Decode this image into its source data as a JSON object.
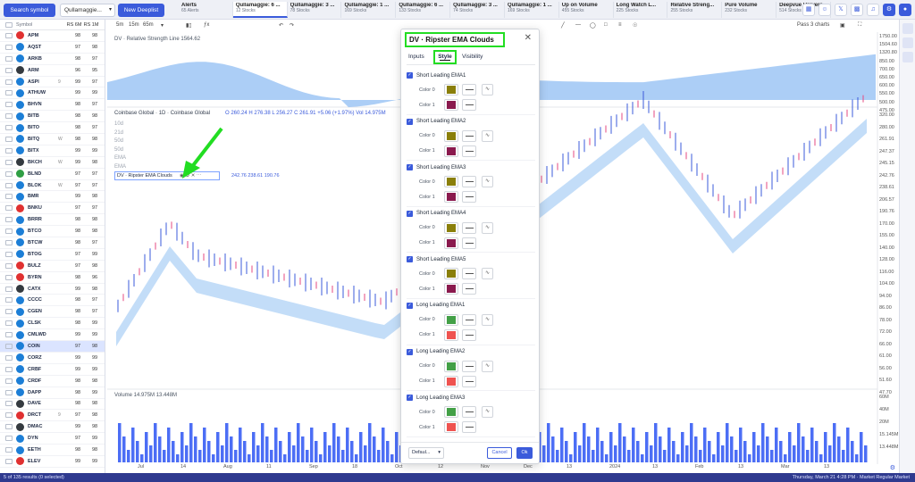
{
  "topbar": {
    "search_label": "Search symbol",
    "deeplist_value": "Qullamaggie...",
    "new_deeplist_label": "New Deeplist",
    "tabs": [
      {
        "title": "Alerts",
        "sub": "65 Alerts"
      },
      {
        "title": "Qullamaggie: 6 ...",
        "sub": "12 Stocks"
      },
      {
        "title": "Qullamaggie: 3 ...",
        "sub": "78 Stocks"
      },
      {
        "title": "Qullamaggie: 1 ...",
        "sub": "169 Stocks"
      },
      {
        "title": "Qullamaggie: 6 ...",
        "sub": "133 Stocks"
      },
      {
        "title": "Qullamaggie: 3 ...",
        "sub": "74 Stocks"
      },
      {
        "title": "Qullamaggie: 1 ...",
        "sub": "169 Stocks"
      },
      {
        "title": "Up on Volume",
        "sub": "455 Stocks"
      },
      {
        "title": "Long Watch L...",
        "sub": "225 Stocks"
      },
      {
        "title": "Relative Streng...",
        "sub": "255 Stocks"
      },
      {
        "title": "Pure Volume",
        "sub": "232 Stocks"
      },
      {
        "title": "Deepvue Univers...",
        "sub": "514 Stocks"
      }
    ]
  },
  "sidebar": {
    "header": {
      "symbol": "Symbol",
      "rs": "RS 6M",
      "m": "RS 1M"
    },
    "rows": [
      {
        "sym": "APM",
        "rs": "98",
        "m": "98",
        "color": "#e03131",
        "mark": ""
      },
      {
        "sym": "AQST",
        "rs": "97",
        "m": "98",
        "color": "#1c7ed6",
        "mark": ""
      },
      {
        "sym": "ARKB",
        "rs": "98",
        "m": "97",
        "color": "#1c7ed6",
        "mark": ""
      },
      {
        "sym": "ARM",
        "rs": "96",
        "m": "95",
        "color": "#343a40",
        "mark": ""
      },
      {
        "sym": "ASPI",
        "rs": "99",
        "m": "97",
        "color": "#1c7ed6",
        "mark": "9"
      },
      {
        "sym": "ATHUW",
        "rs": "99",
        "m": "99",
        "color": "#1c7ed6",
        "mark": ""
      },
      {
        "sym": "BHVN",
        "rs": "98",
        "m": "97",
        "color": "#1c7ed6",
        "mark": ""
      },
      {
        "sym": "BITB",
        "rs": "98",
        "m": "98",
        "color": "#1c7ed6",
        "mark": ""
      },
      {
        "sym": "BITO",
        "rs": "98",
        "m": "97",
        "color": "#1c7ed6",
        "mark": ""
      },
      {
        "sym": "BITQ",
        "rs": "98",
        "m": "98",
        "color": "#1c7ed6",
        "mark": "W"
      },
      {
        "sym": "BITX",
        "rs": "99",
        "m": "99",
        "color": "#1c7ed6",
        "mark": ""
      },
      {
        "sym": "BKCH",
        "rs": "99",
        "m": "98",
        "color": "#343a40",
        "mark": "W"
      },
      {
        "sym": "BLND",
        "rs": "97",
        "m": "97",
        "color": "#2f9e44",
        "mark": ""
      },
      {
        "sym": "BLOK",
        "rs": "97",
        "m": "97",
        "color": "#1c7ed6",
        "mark": "W"
      },
      {
        "sym": "BMR",
        "rs": "99",
        "m": "98",
        "color": "#1c7ed6",
        "mark": ""
      },
      {
        "sym": "BNKU",
        "rs": "97",
        "m": "97",
        "color": "#e03131",
        "mark": ""
      },
      {
        "sym": "BRRR",
        "rs": "98",
        "m": "98",
        "color": "#1c7ed6",
        "mark": ""
      },
      {
        "sym": "BTCO",
        "rs": "98",
        "m": "98",
        "color": "#1c7ed6",
        "mark": ""
      },
      {
        "sym": "BTCW",
        "rs": "98",
        "m": "97",
        "color": "#1c7ed6",
        "mark": ""
      },
      {
        "sym": "BTOG",
        "rs": "97",
        "m": "99",
        "color": "#1c7ed6",
        "mark": ""
      },
      {
        "sym": "BULZ",
        "rs": "97",
        "m": "98",
        "color": "#e03131",
        "mark": ""
      },
      {
        "sym": "BYRN",
        "rs": "98",
        "m": "96",
        "color": "#e03131",
        "mark": ""
      },
      {
        "sym": "CATX",
        "rs": "99",
        "m": "98",
        "color": "#343a40",
        "mark": ""
      },
      {
        "sym": "CCCC",
        "rs": "98",
        "m": "97",
        "color": "#1c7ed6",
        "mark": ""
      },
      {
        "sym": "CGEN",
        "rs": "98",
        "m": "97",
        "color": "#1c7ed6",
        "mark": ""
      },
      {
        "sym": "CLSK",
        "rs": "98",
        "m": "99",
        "color": "#1c7ed6",
        "mark": ""
      },
      {
        "sym": "CMLWD",
        "rs": "99",
        "m": "99",
        "color": "#1c7ed6",
        "mark": ""
      },
      {
        "sym": "COIN",
        "rs": "97",
        "m": "98",
        "color": "#1c7ed6",
        "mark": "",
        "selected": true
      },
      {
        "sym": "CORZ",
        "rs": "99",
        "m": "99",
        "color": "#1c7ed6",
        "mark": ""
      },
      {
        "sym": "CRBF",
        "rs": "99",
        "m": "99",
        "color": "#1c7ed6",
        "mark": ""
      },
      {
        "sym": "CRDF",
        "rs": "98",
        "m": "98",
        "color": "#1c7ed6",
        "mark": ""
      },
      {
        "sym": "DAPP",
        "rs": "98",
        "m": "99",
        "color": "#1c7ed6",
        "mark": ""
      },
      {
        "sym": "DAVE",
        "rs": "98",
        "m": "98",
        "color": "#343a40",
        "mark": ""
      },
      {
        "sym": "DRCT",
        "rs": "97",
        "m": "98",
        "color": "#e03131",
        "mark": "9"
      },
      {
        "sym": "DMAC",
        "rs": "99",
        "m": "98",
        "color": "#343a40",
        "mark": ""
      },
      {
        "sym": "DYN",
        "rs": "97",
        "m": "99",
        "color": "#1c7ed6",
        "mark": ""
      },
      {
        "sym": "EETH",
        "rs": "98",
        "m": "98",
        "color": "#1c7ed6",
        "mark": ""
      },
      {
        "sym": "ELEV",
        "rs": "99",
        "m": "99",
        "color": "#e03131",
        "mark": ""
      }
    ]
  },
  "chart": {
    "timeframes": [
      "5m",
      "15m",
      "65m"
    ],
    "rsl_label": "DV · Relative Strength Line  1564.62",
    "main_label": "Coinbase Global · 1D · Coinbase Global",
    "main_values": "O 260.24  H 276.38  L 256.27  C 261.91  +5.06 (+1.97%)  Vol 14.975M",
    "ma_labels": [
      "10d",
      "21d",
      "50d",
      "50d",
      "EMA",
      "EMA"
    ],
    "indicator_label": "DV · Ripster EMA Clouds",
    "indicator_values": "242.76  238.61  190.76",
    "volume_label": "Volume  14.975M  13.448M",
    "y_axis_rsl": [
      "1750.00",
      "1504.60",
      "1320.80",
      "850.00",
      "700.00",
      "650.00",
      "600.00",
      "550.00",
      "500.00",
      "475.00"
    ],
    "y_axis_price": [
      "320.00",
      "280.00",
      "261.91",
      "247.37",
      "245.15",
      "242.76",
      "238.61",
      "206.57",
      "190.76",
      "170.00",
      "155.00",
      "140.00",
      "128.00",
      "116.00",
      "104.00",
      "94.00",
      "86.00",
      "78.00",
      "72.00",
      "66.00",
      "61.00",
      "56.00",
      "51.60",
      "47.70"
    ],
    "y_axis_volume": [
      "60M",
      "40M",
      "20M",
      "15.145M",
      "13.448M"
    ],
    "x_axis": [
      "Jul",
      "14",
      "Aug",
      "11",
      "Sep",
      "18",
      "Oct",
      "12",
      "Nov",
      "Dec",
      "13",
      "2024",
      "13",
      "Feb",
      "13",
      "Mar",
      "13"
    ],
    "layout_label": "Pass 3 charts"
  },
  "dialog": {
    "title": "DV · Ripster EMA Clouds",
    "tabs": [
      "Inputs",
      "Style",
      "Visibility"
    ],
    "groups": [
      {
        "name": "Short Leading EMA1",
        "c0": "#8a7f0a",
        "c1": "#8a1a4e"
      },
      {
        "name": "Short Leading EMA2",
        "c0": "#8a7f0a",
        "c1": "#8a1a4e"
      },
      {
        "name": "Short Leading EMA3",
        "c0": "#8a7f0a",
        "c1": "#8a1a4e"
      },
      {
        "name": "Short Leading EMA4",
        "c0": "#8a7f0a",
        "c1": "#8a1a4e"
      },
      {
        "name": "Short Leading EMA5",
        "c0": "#8a7f0a",
        "c1": "#8a1a4e"
      },
      {
        "name": "Long Leading EMA1",
        "c0": "#43a047",
        "c1": "#ef5350"
      },
      {
        "name": "Long Leading EMA2",
        "c0": "#43a047",
        "c1": "#ef5350"
      },
      {
        "name": "Long Leading EMA3",
        "c0": "#43a047",
        "c1": "#ef5350"
      }
    ],
    "color0_label": "Color 0",
    "color1_label": "Color 1",
    "default_label": "Defaul...",
    "cancel_label": "Cancel",
    "ok_label": "Ok"
  },
  "status": {
    "left": "5 of 135 results (0 selected)",
    "right": "Thursday, March 21  4:28 PM  ·  Market Regular Market"
  }
}
